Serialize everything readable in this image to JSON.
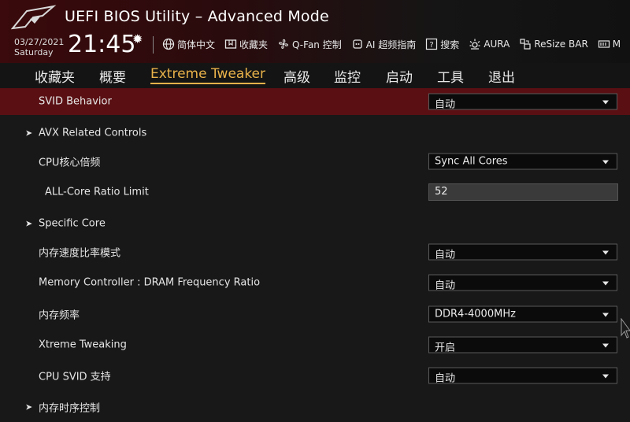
{
  "header": {
    "title": "UEFI BIOS Utility – Advanced Mode",
    "date": "03/27/2021",
    "day": "Saturday",
    "time": "21:45",
    "logo_icon": "rog-eye-logo-icon",
    "tools": [
      {
        "icon": "globe-icon",
        "label": "简体中文"
      },
      {
        "icon": "bookmark-folder-icon",
        "label": "收藏夹"
      },
      {
        "icon": "fan-icon",
        "label": "Q-Fan 控制"
      },
      {
        "icon": "ai-chip-icon",
        "label": "AI 超频指南"
      },
      {
        "icon": "help-icon",
        "label": "搜索"
      },
      {
        "icon": "aura-light-icon",
        "label": "AURA"
      },
      {
        "icon": "resize-bar-icon",
        "label": "ReSize BAR"
      },
      {
        "icon": "memtest-icon",
        "label": "M"
      }
    ]
  },
  "tabs": [
    "收藏夹",
    "概要",
    "Extreme Tweaker",
    "高级",
    "监控",
    "启动",
    "工具",
    "退出"
  ],
  "active_tab": "Extreme Tweaker",
  "colors": {
    "accent": "#e9b24a",
    "selected_row": "#5a1013",
    "background": "#181818"
  },
  "settings": [
    {
      "label": "SVID Behavior",
      "type": "dropdown",
      "value": "自动"
    },
    {
      "label": "AVX Related Controls",
      "type": "submenu"
    },
    {
      "label": "CPU核心倍频",
      "type": "dropdown",
      "value": "Sync All Cores"
    },
    {
      "label": "ALL-Core Ratio Limit",
      "type": "input",
      "value": "52"
    },
    {
      "label": "Specific Core",
      "type": "submenu"
    },
    {
      "label": "内存速度比率模式",
      "type": "dropdown",
      "value": "自动"
    },
    {
      "label": "Memory Controller : DRAM Frequency Ratio",
      "type": "dropdown",
      "value": "自动"
    },
    {
      "label": "内存频率",
      "type": "dropdown",
      "value": "DDR4-4000MHz"
    },
    {
      "label": "Xtreme Tweaking",
      "type": "dropdown",
      "value": "开启"
    },
    {
      "label": "CPU SVID 支持",
      "type": "dropdown",
      "value": "自动"
    },
    {
      "label": "内存时序控制",
      "type": "submenu"
    }
  ]
}
